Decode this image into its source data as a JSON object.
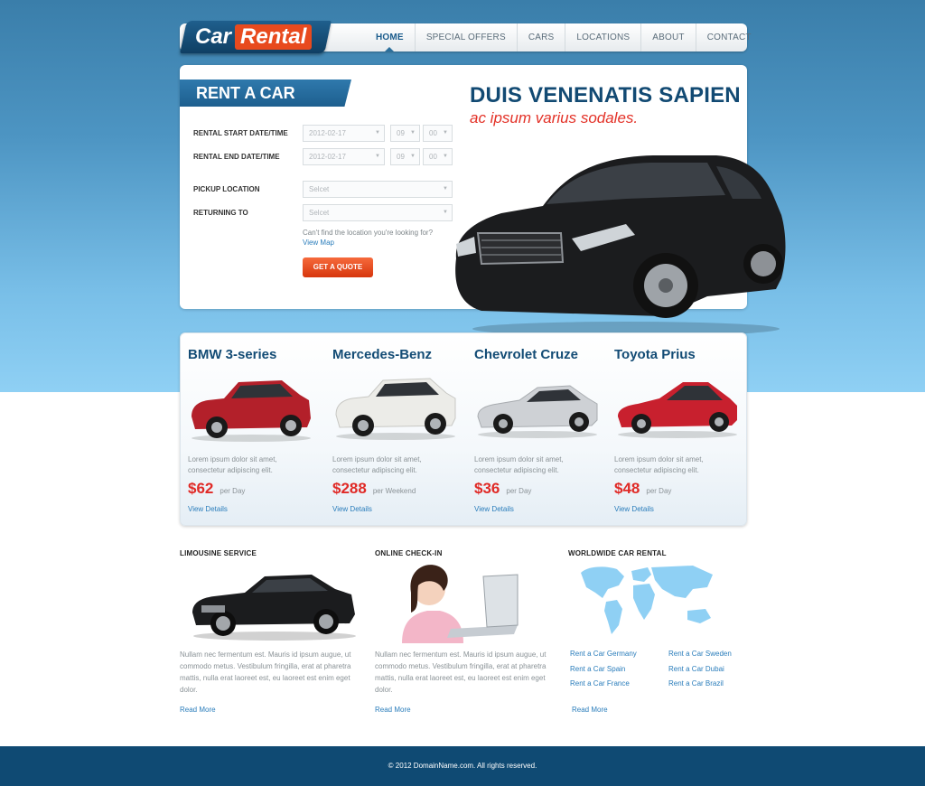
{
  "brand": {
    "part1": "Car",
    "part2": "Rental"
  },
  "nav": {
    "items": [
      "HOME",
      "SPECIAL OFFERS",
      "CARS",
      "LOCATIONS",
      "ABOUT",
      "CONTACT"
    ],
    "active": "HOME"
  },
  "rent_form": {
    "title": "RENT A CAR",
    "start_label": "RENTAL START DATE/TIME",
    "end_label": "RENTAL END DATE/TIME",
    "start_date": "2012-02-17",
    "end_date": "2012-02-17",
    "start_hour": "09",
    "start_min": "00",
    "end_hour": "09",
    "end_min": "00",
    "pickup_label": "PICKUP LOCATION",
    "returning_label": "RETURNING TO",
    "select_placeholder": "Selcet",
    "help_text": "Can't find the location you're looking for?",
    "view_map": "View Map",
    "quote_button": "GET A QUOTE"
  },
  "hero": {
    "headline": "DUIS VENENATIS SAPIEN",
    "subhead": "ac ipsum varius sodales."
  },
  "cars": [
    {
      "name": "BMW 3-series",
      "desc1": "Lorem ipsum dolor sit amet,",
      "desc2": "consectetur adipiscing elit.",
      "price": "$62",
      "period": "per Day",
      "details": "View Details",
      "color": "#b3202a"
    },
    {
      "name": "Mercedes-Benz",
      "desc1": "Lorem ipsum dolor sit amet,",
      "desc2": "consectetur adipiscing elit.",
      "price": "$288",
      "period": "per Weekend",
      "details": "View Details",
      "color": "#e9e9e6"
    },
    {
      "name": "Chevrolet Cruze",
      "desc1": "Lorem ipsum dolor sit amet,",
      "desc2": "consectetur adipiscing elit.",
      "price": "$36",
      "period": "per Day",
      "details": "View Details",
      "color": "#c9ccd0"
    },
    {
      "name": "Toyota Prius",
      "desc1": "Lorem ipsum dolor sit amet,",
      "desc2": "consectetur adipiscing elit.",
      "price": "$48",
      "period": "per Day",
      "details": "View Details",
      "color": "#c8202e"
    }
  ],
  "features": {
    "limo": {
      "title": "LIMOUSINE SERVICE",
      "text": "Nullam nec fermentum est. Mauris id ipsum augue, ut commodo metus. Vestibulum fringilla, erat at pharetra mattis, nulla erat laoreet est, eu laoreet est enim eget dolor.",
      "read_more": "Read More"
    },
    "checkin": {
      "title": "ONLINE CHECK-IN",
      "text": "Nullam nec fermentum est. Mauris id ipsum augue, ut commodo metus. Vestibulum fringilla, erat at pharetra mattis, nulla erat laoreet est, eu laoreet est enim eget dolor.",
      "read_more": "Read More"
    },
    "world": {
      "title": "WORLDWIDE CAR RENTAL",
      "links": [
        "Rent a Car Germany",
        "Rent a Car Sweden",
        "Rent a Car Spain",
        "Rent a Car Dubai",
        "Rent a Car France",
        "Rent a Car Brazil"
      ],
      "read_more": "Read More"
    }
  },
  "footer": {
    "text": "© 2012 DomainName.com. All rights reserved."
  },
  "colors": {
    "accent": "#e84a1e",
    "brand_blue": "#124a73",
    "link": "#2a7dbb",
    "price": "#e02a26"
  }
}
